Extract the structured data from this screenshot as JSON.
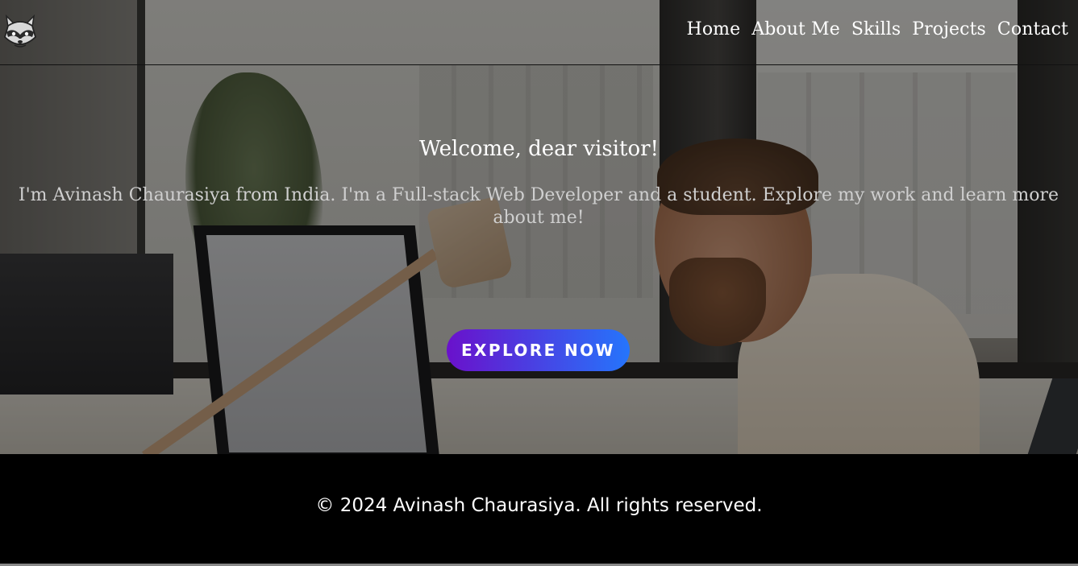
{
  "brand": {
    "logo_icon": "raccoon-logo-icon"
  },
  "nav": {
    "items": [
      {
        "label": "Home"
      },
      {
        "label": "About Me"
      },
      {
        "label": "Skills"
      },
      {
        "label": "Projects"
      },
      {
        "label": "Contact"
      }
    ]
  },
  "hero": {
    "title": "Welcome, dear visitor!",
    "intro": "I'm Avinash Chaurasiya from India. I'm a Full-stack Web Developer and a student. Explore my work and learn more about me!",
    "cta_label": "EXPLORE NOW",
    "cta_gradient": [
      "#6a11cb",
      "#2575fc"
    ]
  },
  "footer": {
    "copyright": "© 2024 Avinash Chaurasiya. All rights reserved."
  }
}
